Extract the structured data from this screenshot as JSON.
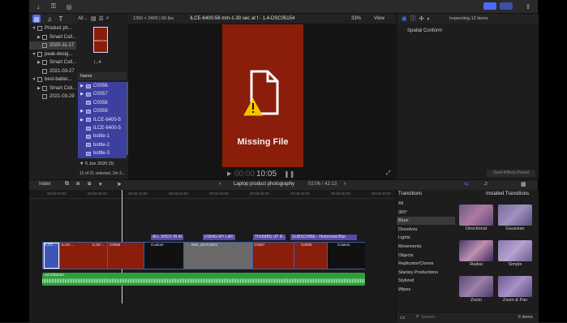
{
  "toolbar": {
    "library_popup": "All",
    "resolution": "1350 × 2400 | 60 fps",
    "clip_title": "ILCE-6400-56 mm-1-30 sec at f - 1,4-DSC05154",
    "zoom": "33%",
    "view": "View",
    "inspecting": "Inspecting 12 items"
  },
  "libraries": [
    {
      "label": "Product ph...",
      "indent": 0,
      "kind": "library",
      "arrow": "▼"
    },
    {
      "label": "Smart Coll...",
      "indent": 1,
      "kind": "folder",
      "arrow": "▶"
    },
    {
      "label": "2020-11-17",
      "indent": 1,
      "kind": "event",
      "arrow": "",
      "selected": true
    },
    {
      "label": "peak-desig...",
      "indent": 0,
      "kind": "library",
      "arrow": "▼"
    },
    {
      "label": "Smart Coll...",
      "indent": 1,
      "kind": "folder",
      "arrow": "▶"
    },
    {
      "label": "2021-03-27",
      "indent": 1,
      "kind": "event",
      "arrow": ""
    },
    {
      "label": "best-batter...",
      "indent": 0,
      "kind": "library",
      "arrow": "▼"
    },
    {
      "label": "Smart Coll...",
      "indent": 1,
      "kind": "folder",
      "arrow": "▶"
    },
    {
      "label": "2021-03-29",
      "indent": 1,
      "kind": "event",
      "arrow": ""
    }
  ],
  "browser": {
    "thumb_caption": "Missing File",
    "thumb_sub": "I...4",
    "column_header": "Name",
    "items": [
      {
        "label": "C0056",
        "arrow": "▶"
      },
      {
        "label": "C0057",
        "arrow": "▶"
      },
      {
        "label": "C0058",
        "arrow": ""
      },
      {
        "label": "C0059",
        "arrow": "▶"
      },
      {
        "label": "ILCE-6400-5",
        "arrow": "▶"
      },
      {
        "label": "ILCE-6400-5",
        "arrow": ""
      },
      {
        "label": "bottle-1",
        "arrow": ""
      },
      {
        "label": "bottle-2",
        "arrow": ""
      },
      {
        "label": "bottle-3",
        "arrow": ""
      }
    ],
    "group_row": "5 Jun 2020  (3)",
    "status": "12 of 21 selected, 2m 2..."
  },
  "viewer": {
    "missing_label": "Missing File",
    "timecode": "10:05",
    "timecode_dim": "00:00",
    "bg_color": "#8b1d0b"
  },
  "inspector": {
    "property": "Spatial Conform",
    "save_preset": "Save Effects Preset"
  },
  "timeline": {
    "index_label": "Index",
    "project_name": "Laptop product photography",
    "duration": "02:06 / 42:13",
    "ruler": [
      "00:00:00:00",
      "00:00:05:00",
      "00:00:10:00",
      "00:00:15:00",
      "00:00:20:00",
      "00:00:25:00",
      "00:00:30:00",
      "00:00:35:00",
      "00:00:40:00"
    ],
    "titles": [
      "ALL SHOT IN M...",
      "USING MY LAP...",
      "THUMBS UP IF...",
      "SUBSCRIBE - Horizontal Blur"
    ],
    "clip_labels": [
      "ILCE-...",
      "ILCE-...",
      "ILCE-...",
      "C0056",
      "Custom",
      "IMG_2573.MOV",
      "C0057",
      "C0059",
      "Custom"
    ],
    "audio_label": "Ad Infinitum"
  },
  "transitions": {
    "header": "Transitions",
    "installed_label": "Installed Transitions",
    "categories": [
      "All",
      "360°",
      "Blurs",
      "Dissolves",
      "Lights",
      "Movements",
      "Objects",
      "Replicator/Clones",
      "Stanley Productions",
      "Stylized",
      "Wipes"
    ],
    "selected_category": "Blurs",
    "items": [
      "Directional",
      "Gaussian",
      "Radial",
      "Simple",
      "Zoom",
      "Zoom & Pan"
    ],
    "search_placeholder": "Search",
    "count": "6 items"
  },
  "colors": {
    "accent": "#4a6cf7",
    "selection_blue": "#3c3f9e",
    "missing_red": "#8b1d0b",
    "audio_green": "#2f9e3f",
    "title_purple": "#5a4aa8"
  }
}
